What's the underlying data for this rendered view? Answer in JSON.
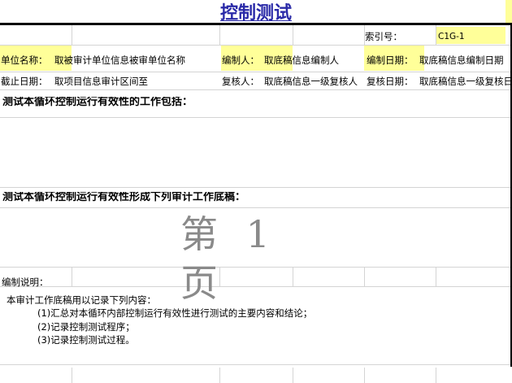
{
  "title": "控制测试",
  "index": {
    "label": "索引号：",
    "value": "C1G-1"
  },
  "unit": {
    "label": "单位名称：",
    "value": "取被审计单位信息被审单位名称"
  },
  "preparer": {
    "label": "编制人：",
    "value": "取底稿信息编制人"
  },
  "prep_date": {
    "label": "编制日期：",
    "value": "取底稿信息编制日期"
  },
  "cutoff": {
    "label": "截止日期：",
    "value": "取项目信息审计区间至"
  },
  "reviewer": {
    "label": "复核人：",
    "value": "取底稿信息一级复核人"
  },
  "review_date": {
    "label": "复核日期：",
    "value": "取底稿信息一级复核日期"
  },
  "section1": "测试本循环控制运行有效性的工作包括：",
  "section2": "测试本循环控制运行有效性形成下列审计工作底稿：",
  "page_mark": "第 1 页",
  "notes": {
    "heading": "编制说明：",
    "intro": "本审计工作底稿用以记录下列内容：",
    "items": [
      "(1)汇总对本循环内部控制运行有效性进行测试的主要内容和结论；",
      "(2)记录控制测试程序；",
      "(3)记录控制测试过程。"
    ]
  },
  "colors": {
    "title": "#2a2aa8",
    "highlight": "#ffff99"
  }
}
